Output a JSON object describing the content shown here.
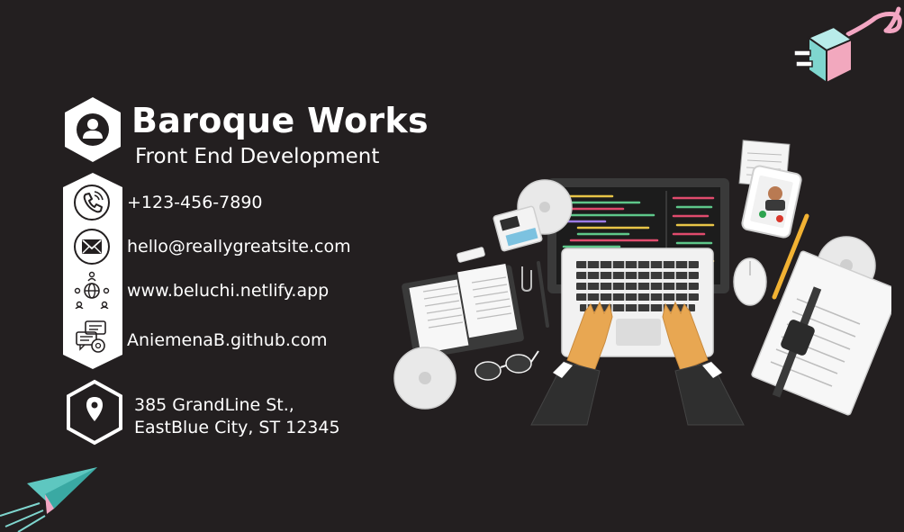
{
  "card": {
    "name": "Baroque Works",
    "role": "Front End Development",
    "contacts": [
      {
        "icon": "phone-icon",
        "text": "+123-456-7890"
      },
      {
        "icon": "email-icon",
        "text": "hello@reallygreatsite.com"
      },
      {
        "icon": "globe-network-icon",
        "text": "www.beluchi.netlify.app"
      },
      {
        "icon": "chat-icon",
        "text": "AniemenaB.github.com"
      }
    ],
    "address": {
      "icon": "location-pin-icon",
      "line1": "385 GrandLine St.,",
      "line2": "EastBlue City, ST 12345"
    }
  },
  "colors": {
    "background": "#231f20",
    "text": "#ffffff",
    "accent_plug": "#7fd6cf",
    "accent_cable": "#f3a6c3",
    "accent_plane": "#5ec7c0",
    "hand": "#e8a752",
    "pencil": "#f2b233"
  },
  "decorations": {
    "profile_icon": "user-icon",
    "illustration": "laptop-workspace-illustration",
    "top_right": "power-plug-icon",
    "bottom_left": "paper-plane-icon"
  }
}
